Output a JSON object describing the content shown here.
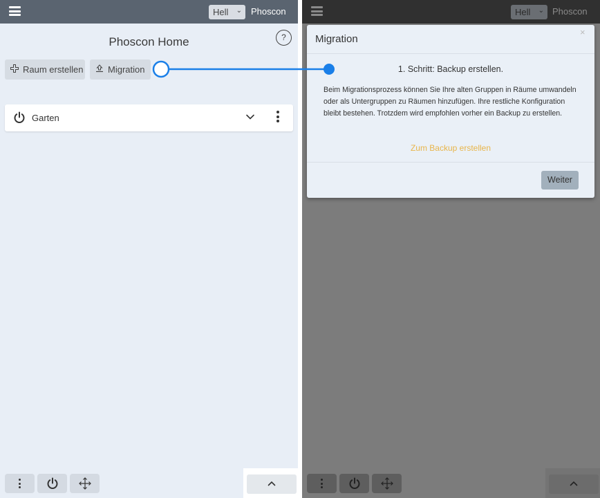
{
  "left": {
    "topbar": {
      "menu_icon": "hamburger-icon",
      "theme_value": "Hell",
      "brand": "Phoscon"
    },
    "page_title": "Phoscon Home",
    "help_label": "?",
    "toolbar": {
      "create_room_label": "Raum erstellen",
      "create_room_icon": "plus-outline-icon",
      "migration_label": "Migration",
      "migration_icon": "upload-icon"
    },
    "rooms": [
      {
        "name": "Garten"
      }
    ],
    "bottom": {
      "icons": [
        "kebab-icon",
        "power-icon",
        "move-icon"
      ],
      "expand_icon": "chevron-up-icon"
    }
  },
  "right": {
    "topbar": {
      "theme_value": "Hell",
      "brand": "Phoscon"
    },
    "dialog": {
      "title": "Migration",
      "close": "×",
      "step": "1. Schritt: Backup erstellen.",
      "body": "Beim Migrationsprozess können Sie Ihre alten Gruppen in Räume umwandeln oder als Untergruppen zu Räumen hinzufügen. Ihre restliche Konfiguration bleibt bestehen. Trotzdem wird empfohlen vorher ein Backup zu erstellen.",
      "link": "Zum Backup erstellen",
      "next_label": "Weiter"
    }
  },
  "colors": {
    "accent": "#1a7fe8",
    "link": "#e8b54a",
    "topbar": "#5a6470",
    "background": "#e8eef6"
  }
}
